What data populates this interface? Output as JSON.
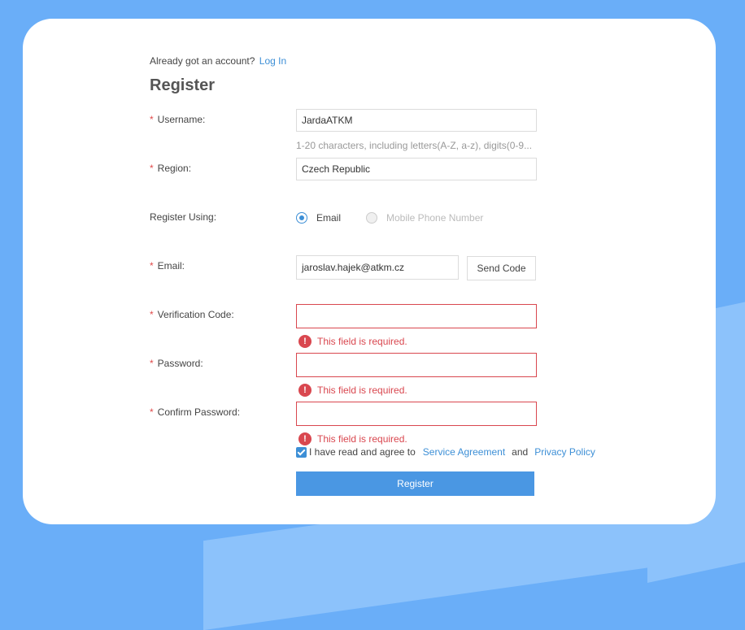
{
  "login_prompt": {
    "text": "Already got an account?",
    "link": "Log In"
  },
  "title": "Register",
  "fields": {
    "username": {
      "label": "Username:",
      "value": "JardaATKM",
      "hint": "1-20 characters, including letters(A-Z, a-z), digits(0-9..."
    },
    "region": {
      "label": "Region:",
      "value": "Czech Republic"
    },
    "register_using": {
      "label": "Register Using:",
      "options": [
        "Email",
        "Mobile Phone Number"
      ],
      "selected": "Email"
    },
    "email": {
      "label": "Email:",
      "value": "jaroslav.hajek@atkm.cz",
      "send_code": "Send Code"
    },
    "verification_code": {
      "label": "Verification Code:",
      "value": "",
      "error": "This field is required."
    },
    "password": {
      "label": "Password:",
      "value": "",
      "error": "This field is required."
    },
    "confirm_password": {
      "label": "Confirm Password:",
      "value": "",
      "error": "This field is required."
    }
  },
  "required_mark": "*",
  "error_icon": "!",
  "agreement": {
    "checked": true,
    "prefix": "I have read and agree to",
    "service_link": "Service Agreement",
    "and": "and",
    "privacy_link": "Privacy Policy"
  },
  "submit_label": "Register",
  "colors": {
    "accent": "#3d8fd6",
    "button": "#4a97e3",
    "error": "#d9474f",
    "background": "#6aaef8"
  }
}
